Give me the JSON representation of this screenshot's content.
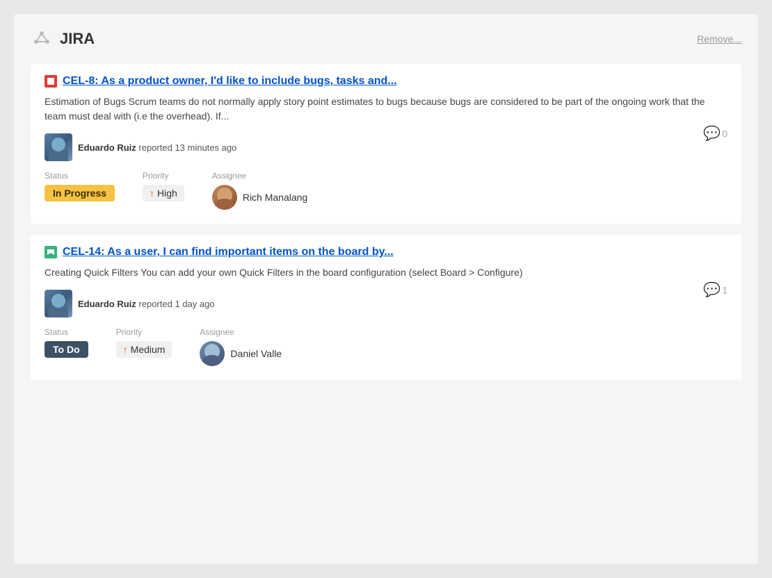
{
  "header": {
    "title": "JIRA",
    "remove_label": "Remove..."
  },
  "issues": [
    {
      "id": "issue-1",
      "type": "bug",
      "type_label": "Bug",
      "issue_key": "CEL-8",
      "title": "CEL-8: As a product owner, I'd like to include bugs, tasks and...",
      "description": "Estimation of Bugs Scrum teams do not normally apply story point estimates to bugs because bugs are considered to be part of the ongoing work that the team must deal with (i.e the overhead). If...",
      "reporter": {
        "name": "Eduardo Ruiz",
        "time": "reported 13 minutes ago"
      },
      "comments": "0",
      "status": {
        "label": "In Progress",
        "type": "in-progress"
      },
      "priority": {
        "label": "High",
        "type": "high"
      },
      "assignee": {
        "name": "Rich Manalang",
        "avatar_type": "1"
      },
      "status_label": "Status",
      "priority_label": "Priority",
      "assignee_label": "Assignee"
    },
    {
      "id": "issue-2",
      "type": "story",
      "type_label": "Story",
      "issue_key": "CEL-14",
      "title": "CEL-14: As a user, I can find important items on the board by...",
      "description": "Creating Quick Filters You can add your own Quick Filters in the board configuration (select Board > Configure)",
      "reporter": {
        "name": "Eduardo Ruiz",
        "time": "reported 1 day ago"
      },
      "comments": "1",
      "status": {
        "label": "To Do",
        "type": "todo"
      },
      "priority": {
        "label": "Medium",
        "type": "medium"
      },
      "assignee": {
        "name": "Daniel Valle",
        "avatar_type": "2"
      },
      "status_label": "Status",
      "priority_label": "Priority",
      "assignee_label": "Assignee"
    }
  ]
}
